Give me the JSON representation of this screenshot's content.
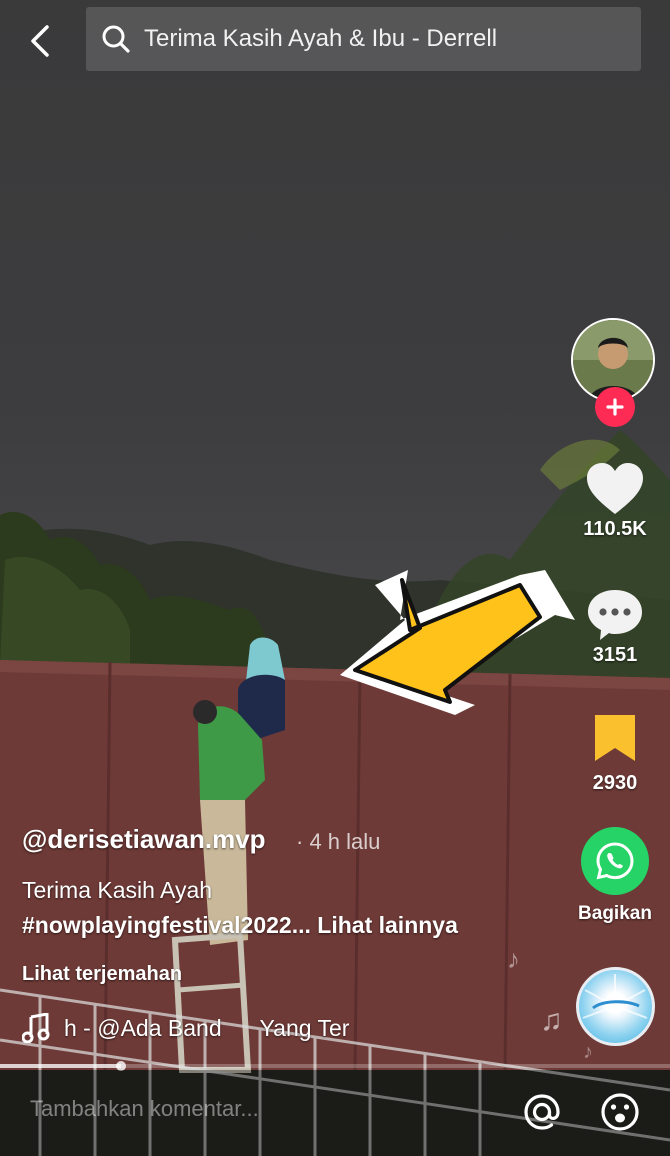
{
  "search": {
    "query": "Terima Kasih Ayah & Ibu - Derrell"
  },
  "rail": {
    "likes": "110.5K",
    "comments": "3151",
    "saves": "2930",
    "share_label": "Bagikan"
  },
  "post": {
    "username": "@derisetiawan.mvp",
    "time": "· 4 h lalu",
    "caption": "Terima Kasih Ayah",
    "hashtags": "#nowplayingfestival2022...",
    "more_label": "Lihat lainnya",
    "translate_label": "Lihat terjemahan",
    "music": "h - @Ada Band      Yang Ter",
    "progress": 0.18
  },
  "comment": {
    "placeholder": "Tambahkan komentar..."
  },
  "colors": {
    "accent": "#fe2c55",
    "bookmark": "#fbc02d",
    "whatsapp": "#25d366",
    "arrow": "#ffc21a"
  }
}
